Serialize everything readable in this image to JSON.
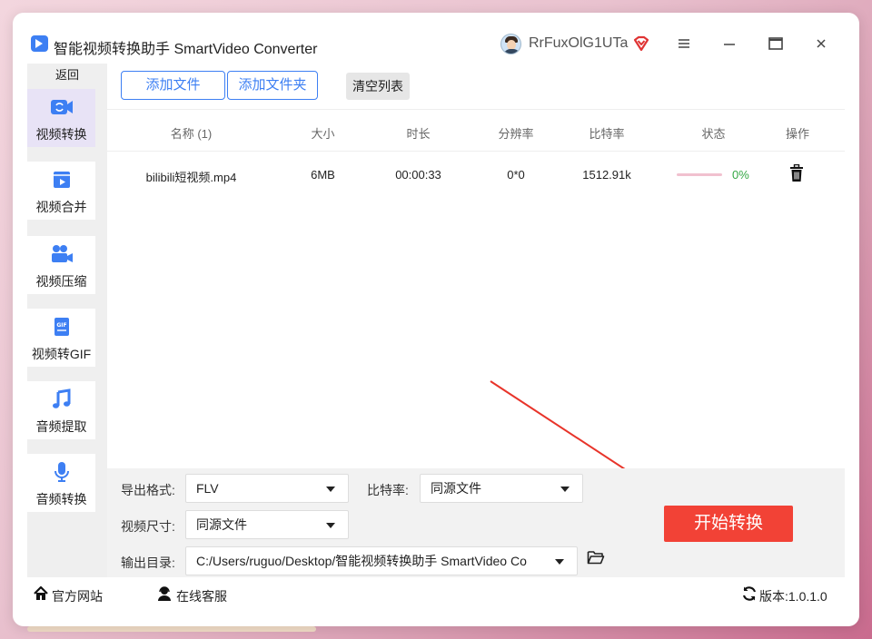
{
  "window": {
    "title": "智能视频转换助手 SmartVideo Converter",
    "username": "RrFuxOlG1UTa"
  },
  "sidebar": {
    "back_label": "返回",
    "items": [
      {
        "label": "视频转换",
        "icon": "convert-icon",
        "active": true
      },
      {
        "label": "视频合并",
        "icon": "merge-icon"
      },
      {
        "label": "视频压缩",
        "icon": "camera-icon"
      },
      {
        "label": "视频转GIF",
        "icon": "gif-icon"
      },
      {
        "label": "音频提取",
        "icon": "music-icon"
      },
      {
        "label": "音频转换",
        "icon": "microphone-icon"
      }
    ]
  },
  "toolbar": {
    "add_file": "添加文件",
    "add_folder": "添加文件夹",
    "clear_list": "清空列表"
  },
  "table": {
    "headers": [
      "名称 (1)",
      "大小",
      "时长",
      "分辨率",
      "比特率",
      "状态",
      "操作"
    ],
    "rows": [
      {
        "name": "bilibili短视频.mp4",
        "size": "6MB",
        "duration": "00:00:33",
        "resolution": "0*0",
        "bitrate": "1512.91k",
        "progress": "0%"
      }
    ]
  },
  "settings": {
    "format_label": "导出格式:",
    "format_value": "FLV",
    "bitrate_label": "比特率:",
    "bitrate_value": "同源文件",
    "size_label": "视频尺寸:",
    "size_value": "同源文件",
    "output_label": "输出目录:",
    "output_value": "C:/Users/ruguo/Desktop/智能视频转换助手 SmartVideo Co",
    "start_button": "开始转换"
  },
  "footer": {
    "website": "官方网站",
    "support": "在线客服",
    "version": "版本:1.0.1.0"
  },
  "colors": {
    "accent": "#3d7ff3",
    "start": "#f24236",
    "progress_text": "#35a845",
    "arrow": "#e8342a"
  }
}
